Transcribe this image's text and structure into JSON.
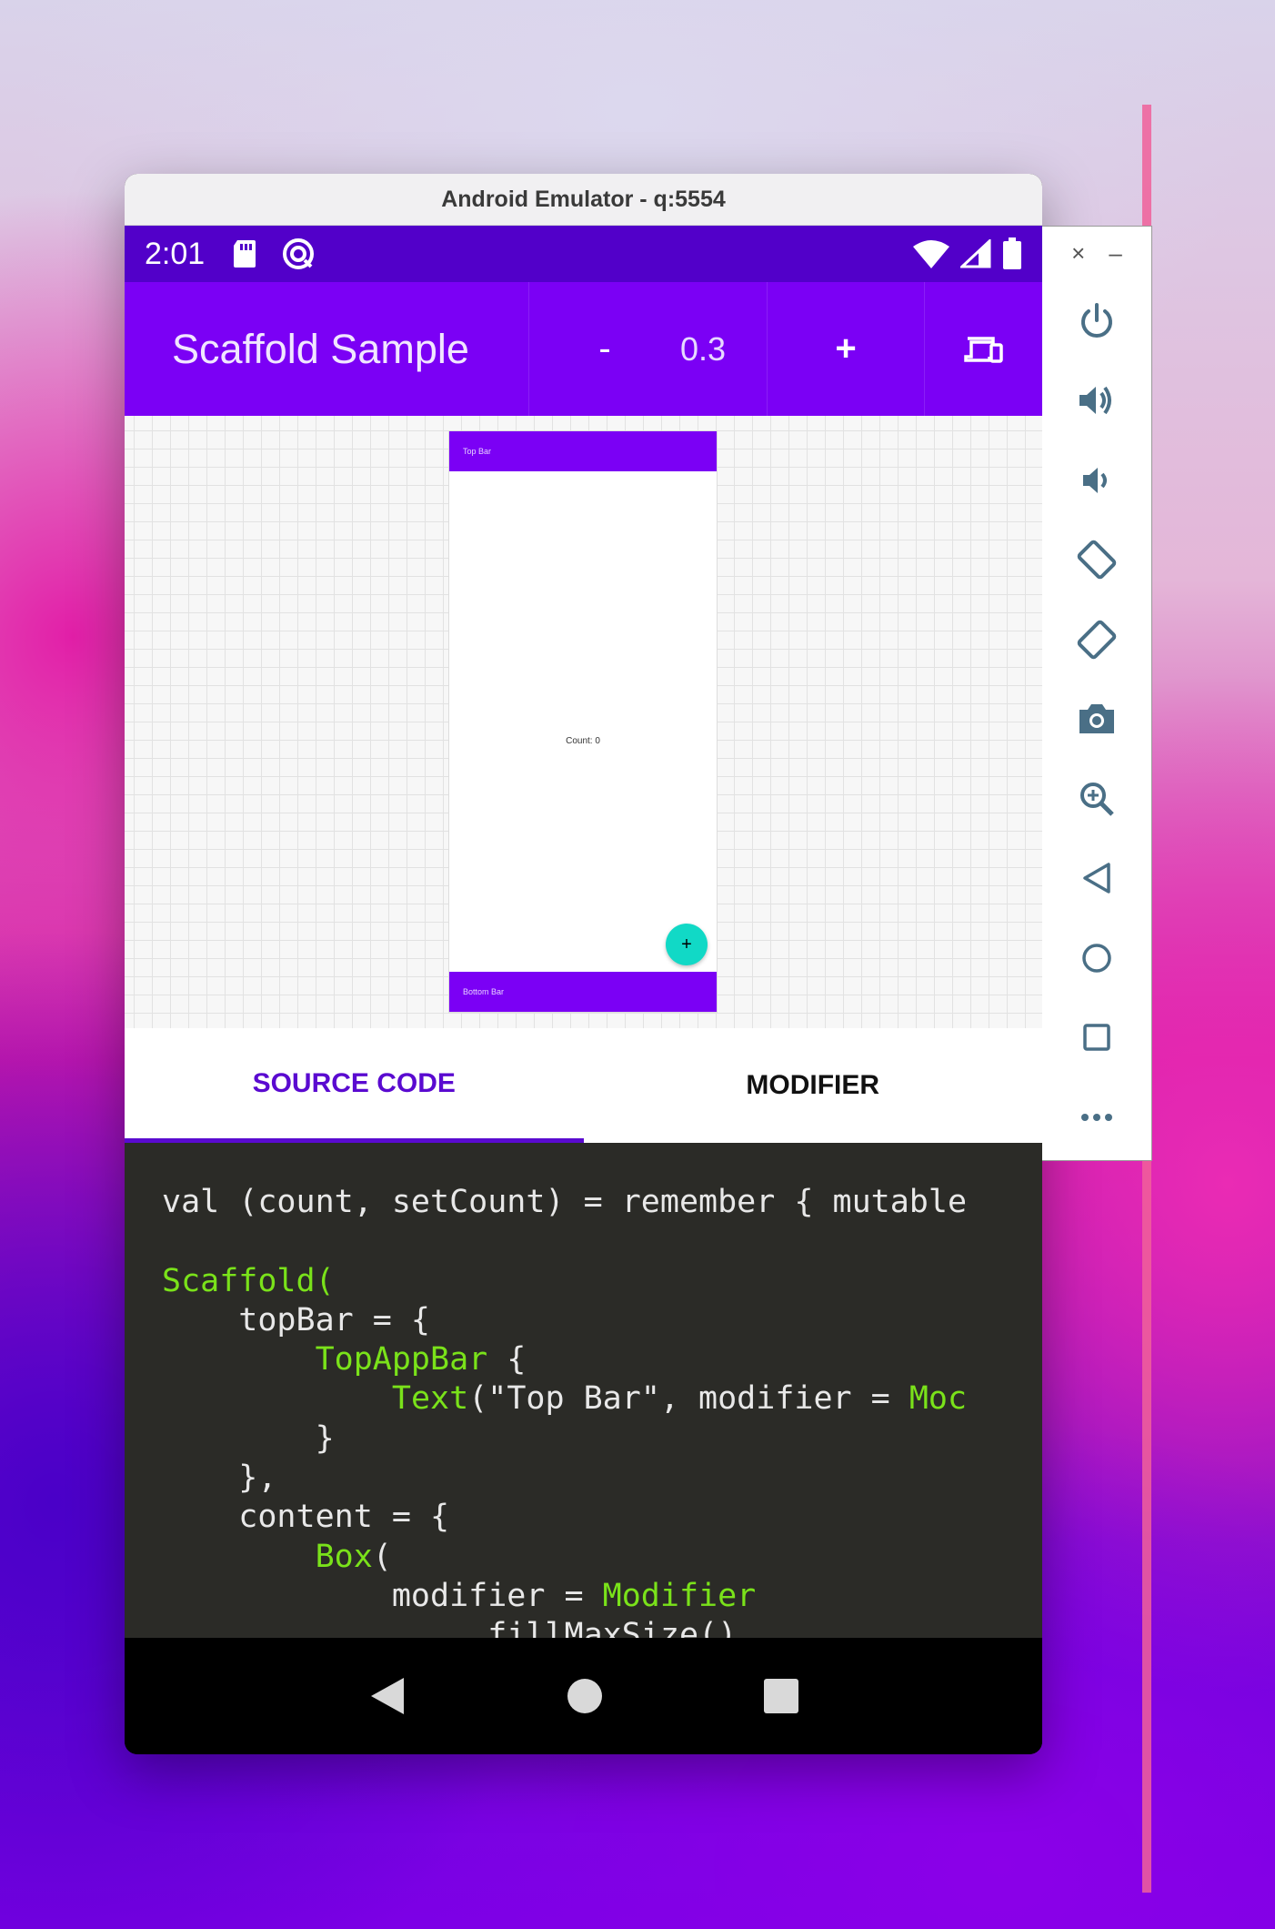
{
  "window": {
    "title": "Android Emulator - q:5554"
  },
  "status_bar": {
    "time": "2:01",
    "icons": [
      "sd-card-icon",
      "sync-icon",
      "wifi-icon",
      "signal-icon",
      "battery-icon"
    ]
  },
  "app_bar": {
    "title": "Scaffold Sample",
    "minus_label": "-",
    "zoom_value": "0.3",
    "plus_label": "+",
    "device_icon": "devices-icon"
  },
  "preview": {
    "top_bar_label": "Top Bar",
    "count_label": "Count: 0",
    "fab_label": "+",
    "bottom_bar_label": "Bottom Bar"
  },
  "tabs": [
    {
      "label": "SOURCE CODE",
      "active": true
    },
    {
      "label": "MODIFIER",
      "active": false
    }
  ],
  "code": {
    "l1": "val (count, setCount) = remember { mutable",
    "l3a": "Scaffold(",
    "l4": "    topBar = {",
    "l5a": "        TopAppBar",
    "l5b": " {",
    "l6i": "            ",
    "l6a": "Text",
    "l6b": "(\"Top Bar\", modifier = ",
    "l6c": "Moc",
    "l7": "        }",
    "l8": "    },",
    "l9": "    content = {",
    "l10i": "        ",
    "l10a": "Box",
    "l10b": "(",
    "l11": "            modifier = ",
    "l11a": "Modifier",
    "l12": "                .fillMaxSize()"
  },
  "nav_bar": {
    "icons": [
      "back-icon",
      "home-icon",
      "recents-icon"
    ]
  },
  "sidebar": {
    "close_label": "×",
    "minimize_label": "–",
    "items": [
      "power-icon",
      "volume-up-icon",
      "volume-down-icon",
      "rotate-left-icon",
      "rotate-right-icon",
      "camera-icon",
      "zoom-icon",
      "back-icon",
      "home-icon",
      "overview-icon",
      "more-icon"
    ]
  },
  "colors": {
    "status_bar": "#5200c9",
    "app_bar": "#7b00f5",
    "tab_active": "#5a0ad0",
    "code_bg": "#2b2b27",
    "code_keyword": "#7ae21a",
    "fab": "#11d9c6",
    "sidebar_icon": "#4a6f86"
  }
}
